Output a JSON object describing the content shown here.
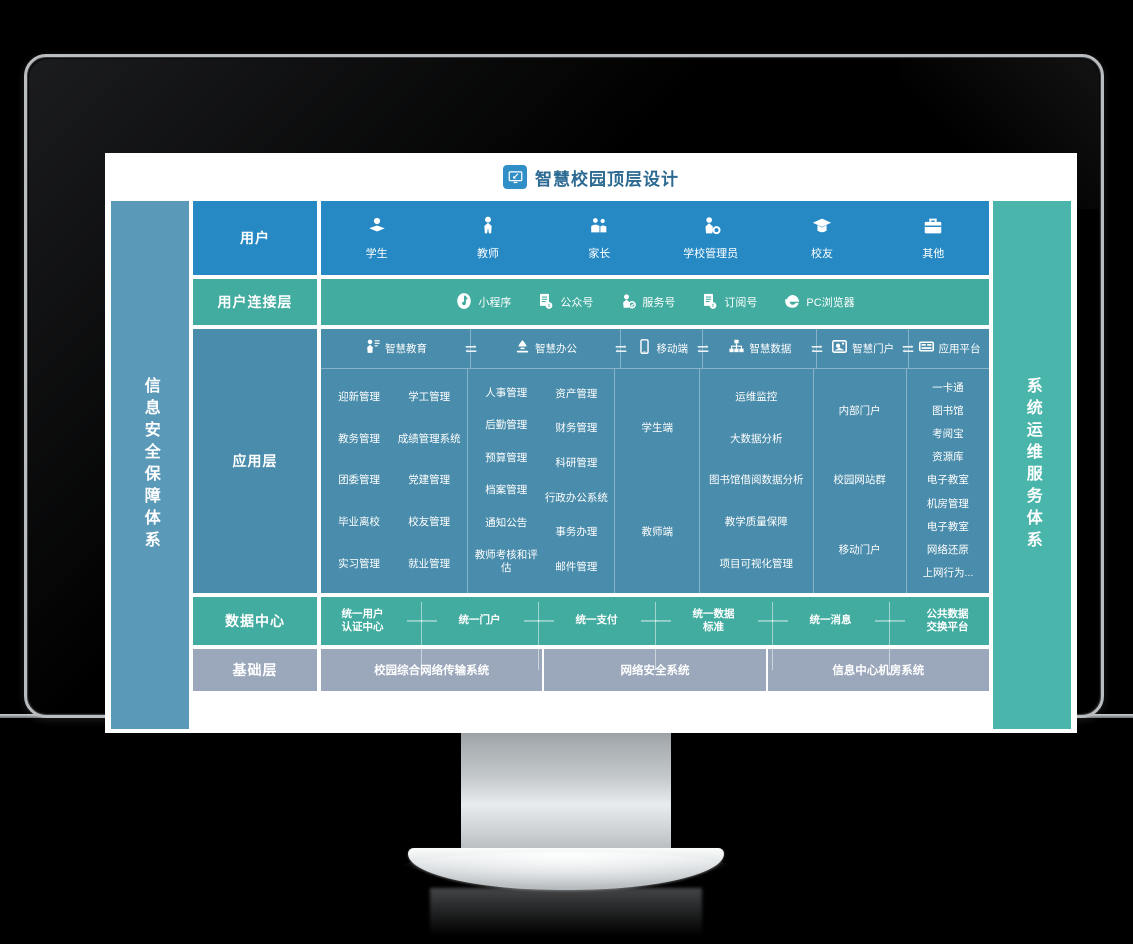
{
  "window": {
    "title": "智慧校园顶层设计",
    "title_icon": "monitor-icon"
  },
  "colors": {
    "blue": "#2689c4",
    "teal": "#41ac9f",
    "slate": "#4a8cab",
    "band_left": "#5b99b8",
    "band_right": "#49b5ab",
    "infra": "#9ba7bb",
    "title_text": "#2c6a92"
  },
  "bands": {
    "left": "信息安全保障体系",
    "right": "系统运维服务体系"
  },
  "rows": {
    "users": {
      "label": "用户",
      "cells": [
        {
          "label": "学生",
          "icon": "student-icon",
          "glyph": "⚇"
        },
        {
          "label": "教师",
          "icon": "teacher-icon",
          "glyph": "⚈"
        },
        {
          "label": "家长",
          "icon": "parents-icon",
          "glyph": "⚉"
        },
        {
          "label": "学校管理员",
          "icon": "admin-gear-icon",
          "glyph": "⚊"
        },
        {
          "label": "校友",
          "icon": "graduate-cap-icon",
          "glyph": "⚋"
        },
        {
          "label": "其他",
          "icon": "briefcase-icon",
          "glyph": "⚌"
        }
      ]
    },
    "connect": {
      "label": "用户连接层",
      "cells": [
        {
          "label": "小程序",
          "icon": "mini-program-icon"
        },
        {
          "label": "公众号",
          "icon": "official-account-icon"
        },
        {
          "label": "服务号",
          "icon": "service-account-icon"
        },
        {
          "label": "订阅号",
          "icon": "subscription-account-icon"
        },
        {
          "label": "PC浏览器",
          "icon": "ie-browser-icon"
        }
      ]
    },
    "application": {
      "label": "应用层",
      "separator_icon": "exchange-arrows-icon",
      "columns": [
        {
          "head": "智慧教育",
          "head_icon": "education-person-icon",
          "two_column": true,
          "left_items": [
            "迎新管理",
            "教务管理",
            "团委管理",
            "毕业离校",
            "实习管理"
          ],
          "right_items": [
            "学工管理",
            "成绩管理系统",
            "党建管理",
            "校友管理",
            "就业管理"
          ]
        },
        {
          "head": "智慧办公",
          "head_icon": "office-lamp-icon",
          "two_column": true,
          "left_items": [
            "人事管理",
            "后勤管理",
            "预算管理",
            "档案管理",
            "通知公告",
            "教师考核和评估"
          ],
          "right_items": [
            "资产管理",
            "财务管理",
            "科研管理",
            "行政办公系统",
            "事务办理",
            "邮件管理"
          ]
        },
        {
          "head": "移动端",
          "head_icon": "mobile-phone-icon",
          "two_column": false,
          "items": [
            "学生端",
            "教师端"
          ]
        },
        {
          "head": "智慧数据",
          "head_icon": "sitemap-icon",
          "two_column": false,
          "items": [
            "运维监控",
            "大数据分析",
            "图书馆借阅数据分析",
            "教学质量保障",
            "项目可视化管理"
          ]
        },
        {
          "head": "智慧门户",
          "head_icon": "portal-window-icon",
          "two_column": false,
          "items": [
            "内部门户",
            "校园网站群",
            "移动门户"
          ]
        },
        {
          "head": "应用平台",
          "head_icon": "app-platform-icon",
          "two_column": false,
          "items": [
            "一卡通",
            "图书馆",
            "考阅宝",
            "资源库",
            "电子教室",
            "机房管理",
            "电子教室",
            "网络还原",
            "上网行为..."
          ]
        }
      ]
    },
    "data_center": {
      "label": "数据中心",
      "separator_icon": "dash-connector",
      "cells": [
        "统一用户\n认证中心",
        "统一门户",
        "统一支付",
        "统一数据\n标准",
        "统一消息",
        "公共数据\n交换平台"
      ]
    },
    "infrastructure": {
      "label": "基础层",
      "cells": [
        "校园综合网络传输系统",
        "网络安全系统",
        "信息中心机房系统"
      ]
    }
  }
}
